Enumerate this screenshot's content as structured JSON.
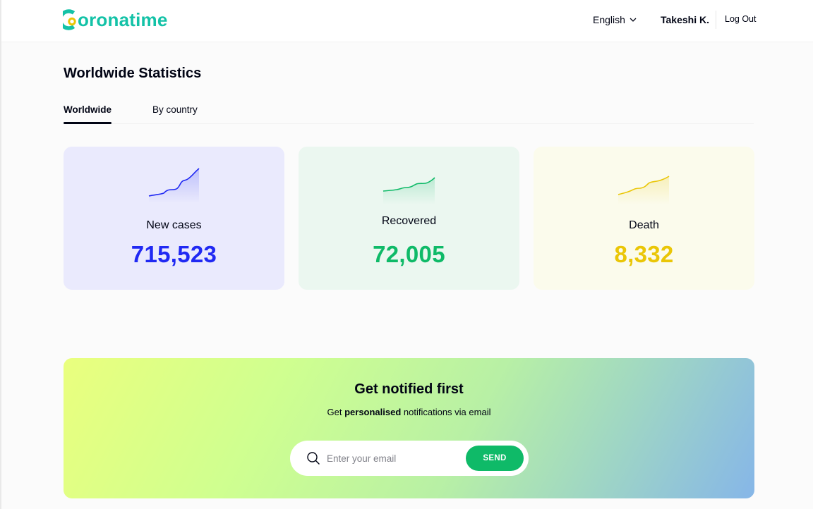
{
  "header": {
    "logo_text": "oronatime",
    "language": "English",
    "user_name": "Takeshi K.",
    "logout_label": "Log Out"
  },
  "page": {
    "title": "Worldwide Statistics",
    "tabs": [
      {
        "label": "Worldwide",
        "active": true
      },
      {
        "label": "By country",
        "active": false
      }
    ]
  },
  "stats": [
    {
      "label": "New cases",
      "value": "715,523",
      "color": "#2029F3",
      "bg": "#EAEAFD"
    },
    {
      "label": "Recovered",
      "value": "72,005",
      "color": "#0FBA68",
      "bg": "#EBF7F0"
    },
    {
      "label": "Death",
      "value": "8,332",
      "color": "#EAC607",
      "bg": "#FBFBEC"
    }
  ],
  "notify": {
    "title": "Get notified first",
    "sub_before": "Get ",
    "sub_bold": "personalised",
    "sub_after": " notifications via email",
    "email_placeholder": "Enter your email",
    "send_label": "SEND"
  },
  "icons": {
    "logo": "coronatime-logo-icon",
    "language_dropdown": "chevron-down-icon",
    "email_search": "search-icon"
  },
  "colors": {
    "brand": "#13C2A7",
    "accent_yellow": "#EAC607",
    "send_button": "#0FBA68"
  }
}
